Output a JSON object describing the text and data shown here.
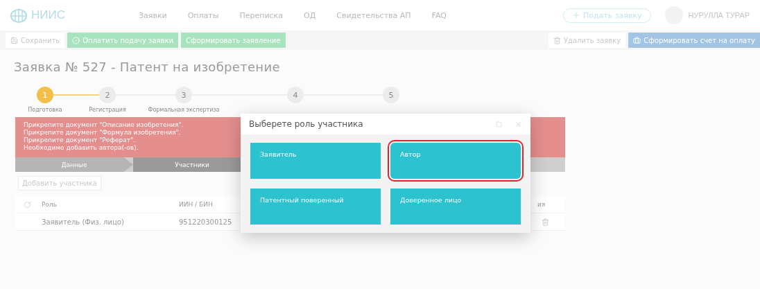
{
  "header": {
    "logo": "НИИС",
    "nav": [
      "Заявки",
      "Оплаты",
      "Переписка",
      "ОД",
      "Свидетельства АП",
      "FAQ"
    ],
    "submit_button": "Подать заявку",
    "user_name": "НУРУЛЛА ТУРАР"
  },
  "toolbar": {
    "left": [
      {
        "label": "Сохранить",
        "kind": "save"
      },
      {
        "label": "Оплатить подачу заявки",
        "kind": "pay"
      },
      {
        "label": "Сформировать заявление",
        "kind": "form"
      }
    ],
    "right": [
      {
        "label": "Удалить заявку",
        "kind": "delete"
      },
      {
        "label": "Сформировать счет на оплату",
        "kind": "invoice"
      }
    ]
  },
  "title": "Заявка № 527 - Патент на изобретение",
  "steps": [
    {
      "number": "1",
      "label": "Подготовка",
      "selected": true
    },
    {
      "number": "2",
      "label": "Регистрация",
      "selected": false
    },
    {
      "number": "3",
      "label": "Формальная экспертиза",
      "selected": false
    },
    {
      "number": "4",
      "selected": false
    },
    {
      "number": "5",
      "selected": false
    }
  ],
  "alert": {
    "lines": [
      "Прикрепите документ \"Описание изобретения\".",
      "Прикрепите документ \"Формула изобретения\".",
      "Прикрепите документ \"Реферат\".",
      "Необходимо добавить автора(-ов)."
    ]
  },
  "section_tabs": [
    {
      "label": "Данные",
      "selected": false
    },
    {
      "label": "Участники",
      "selected": true
    }
  ],
  "add_button": "Добавить участника",
  "table": {
    "columns": [
      "Роль",
      "ИИН / БИН",
      "ия"
    ],
    "rows": [
      {
        "cells": [
          "Заявитель (Физ. лицо)",
          "951220300125"
        ]
      }
    ]
  },
  "modal": {
    "title": "Выберете роль участника",
    "options": [
      {
        "label": "Заявитель",
        "selected": false
      },
      {
        "label": "Автор",
        "selected": true
      },
      {
        "label": "Патентный поверенный",
        "selected": false
      },
      {
        "label": "Доверенное лицо",
        "selected": false
      }
    ]
  }
}
